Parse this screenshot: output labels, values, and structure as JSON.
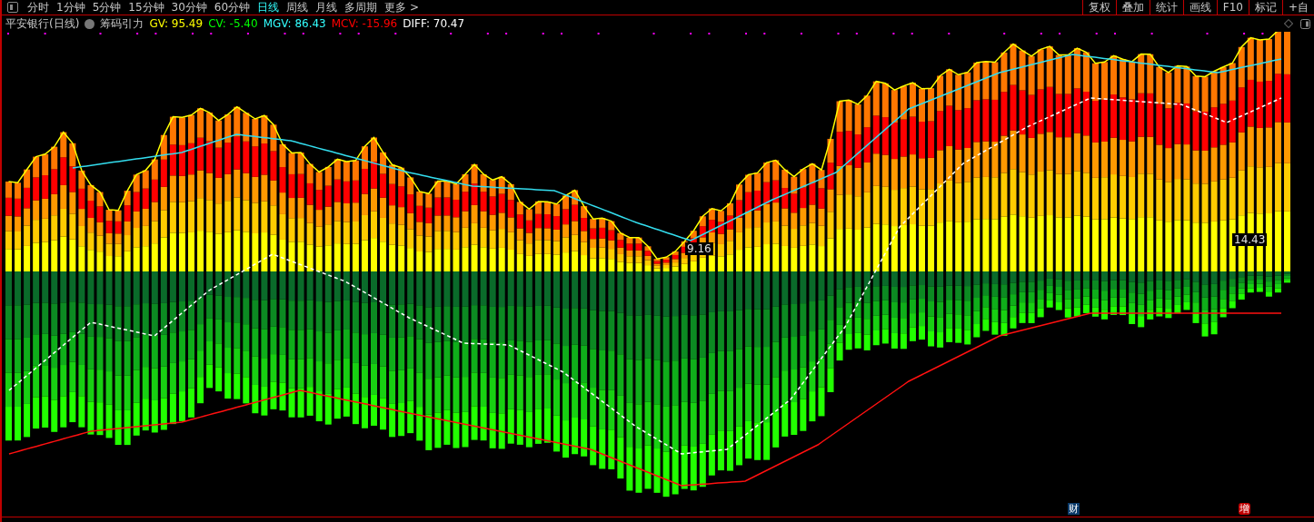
{
  "toolbar": {
    "periods": [
      {
        "label": "分时",
        "selected": false
      },
      {
        "label": "1分钟",
        "selected": false
      },
      {
        "label": "5分钟",
        "selected": false
      },
      {
        "label": "15分钟",
        "selected": false
      },
      {
        "label": "30分钟",
        "selected": false
      },
      {
        "label": "60分钟",
        "selected": false
      },
      {
        "label": "日线",
        "selected": true
      },
      {
        "label": "周线",
        "selected": false
      },
      {
        "label": "月线",
        "selected": false
      },
      {
        "label": "多周期",
        "selected": false
      },
      {
        "label": "更多 >",
        "selected": false
      }
    ],
    "tools": [
      "复权",
      "叠加",
      "统计",
      "画线",
      "F10",
      "标记",
      "+自"
    ]
  },
  "indicator": {
    "title": "平安银行(日线)",
    "name": "筹码引力",
    "values": [
      {
        "text": "GV: 95.49",
        "color": "#ffff00"
      },
      {
        "text": "CV: -5.40",
        "color": "#00ff00"
      },
      {
        "text": "MGV: 86.43",
        "color": "#33ffff"
      },
      {
        "text": "MCV: -15.96",
        "color": "#ff0000"
      },
      {
        "text": "DIFF: 70.47",
        "color": "#ffffff"
      }
    ]
  },
  "chart": {
    "price_labels": [
      "14.43",
      "9.16"
    ],
    "badges": [
      {
        "text": "财",
        "kind": "finance"
      },
      {
        "text": "增",
        "kind": "increase"
      }
    ]
  }
}
